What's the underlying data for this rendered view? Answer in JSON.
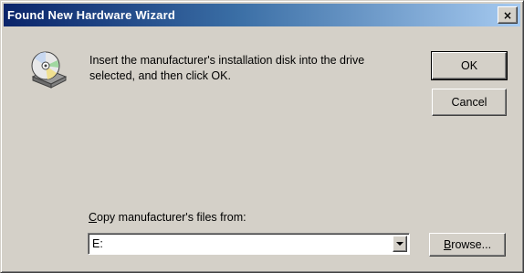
{
  "window": {
    "title": "Found New Hardware Wizard",
    "close_glyph": "×"
  },
  "message": {
    "icon": "install-disk-icon",
    "line1": "Insert the manufacturer's installation disk into the drive",
    "line2": "selected, and then click OK."
  },
  "buttons": {
    "ok_label": "OK",
    "cancel_label": "Cancel",
    "browse_label_underlined": "B",
    "browse_label_rest": "rowse..."
  },
  "copy_from": {
    "label_underlined": "C",
    "label_rest": "opy manufacturer's files from:",
    "value": "E:"
  },
  "colors": {
    "titlebar_start": "#0a246a",
    "titlebar_end": "#a6caf0",
    "face": "#d4d0c8"
  }
}
